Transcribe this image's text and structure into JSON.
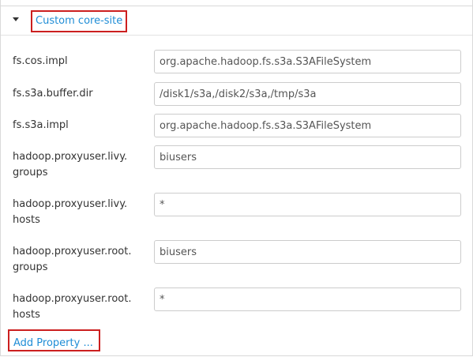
{
  "section": {
    "title": "Custom core-site",
    "collapse_icon": "caret-down-icon"
  },
  "properties": [
    {
      "label": "fs.cos.impl",
      "value": "org.apache.hadoop.fs.s3a.S3AFileSystem"
    },
    {
      "label": "fs.s3a.buffer.dir",
      "value": "/disk1/s3a,/disk2/s3a,/tmp/s3a"
    },
    {
      "label": "fs.s3a.impl",
      "value": "org.apache.hadoop.fs.s3a.S3AFileSystem"
    },
    {
      "label": "hadoop.proxyuser.livy.\ngroups",
      "value": "biusers"
    },
    {
      "label": "hadoop.proxyuser.livy.\nhosts",
      "value": "*"
    },
    {
      "label": "hadoop.proxyuser.root.\ngroups",
      "value": "biusers"
    },
    {
      "label": "hadoop.proxyuser.root.\nhosts",
      "value": "*"
    }
  ],
  "add_property_label": "Add Property ...",
  "colors": {
    "link": "#1f8dd6",
    "highlight_border": "#cc1f1f",
    "input_border": "#cccccc"
  }
}
